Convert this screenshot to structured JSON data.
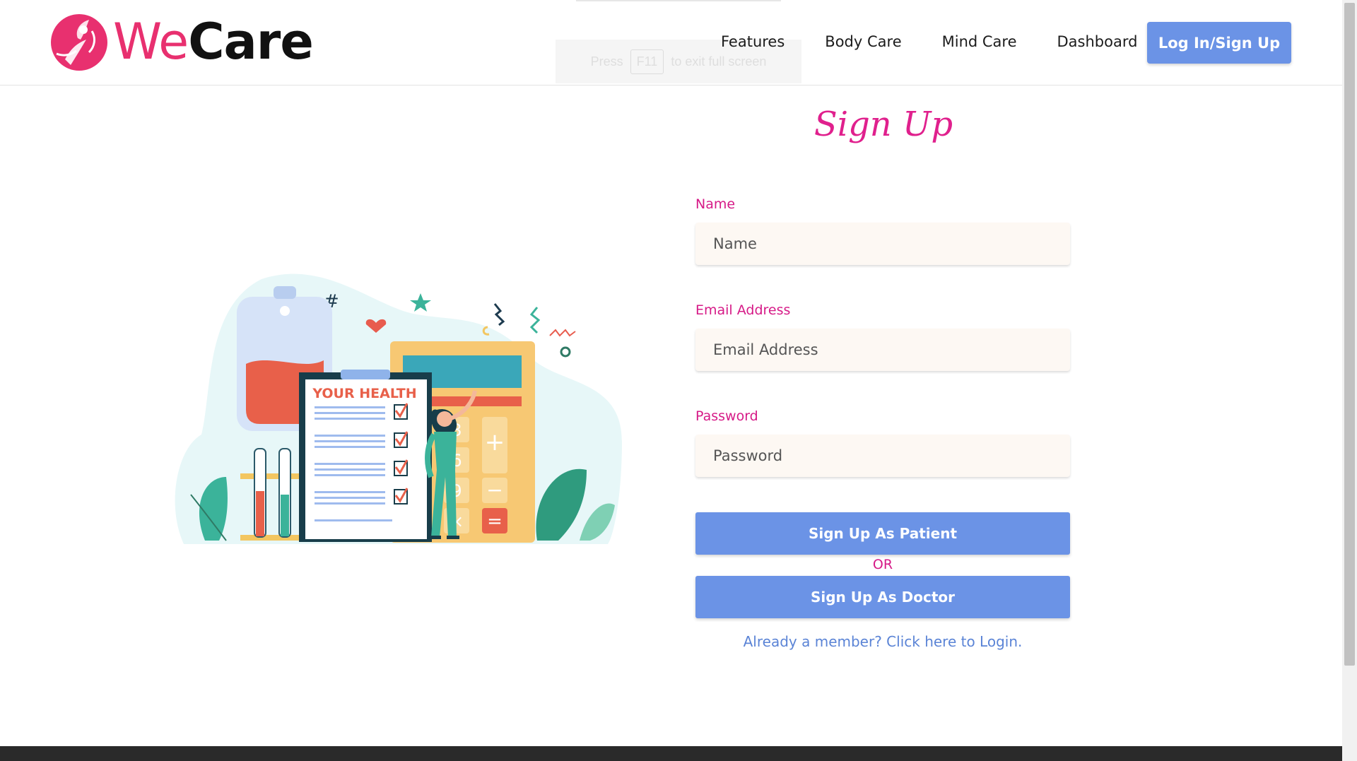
{
  "brand": {
    "prefix": "We",
    "name": "Care",
    "logo_icon": "figure-in-circle-logo",
    "accent": "#e8306f"
  },
  "nav": {
    "items": [
      {
        "label": "Features"
      },
      {
        "label": "Body Care"
      },
      {
        "label": "Mind Care"
      },
      {
        "label": "Dashboard"
      }
    ],
    "login_label": "Log In/Sign Up"
  },
  "fullscreen_toast": {
    "before": "Press",
    "key": "F11",
    "after": "to exit full screen"
  },
  "form": {
    "title": "Sign Up",
    "name": {
      "label": "Name",
      "placeholder": "Name"
    },
    "email": {
      "label": "Email Address",
      "placeholder": "Email Address"
    },
    "password": {
      "label": "Password",
      "placeholder": "Password"
    },
    "patient_button": "Sign Up As Patient",
    "or": "OR",
    "doctor_button": "Sign Up As Doctor",
    "login_link": "Already a member? Click here to Login."
  },
  "illustration": {
    "heading": "YOUR HEALTH",
    "calculator_keys": [
      "3",
      "6",
      "9",
      "+",
      "−",
      "×",
      "="
    ]
  },
  "colors": {
    "primary_button": "#6b93e6",
    "label_pink": "#d61a87",
    "input_bg": "#fdf8f3"
  }
}
